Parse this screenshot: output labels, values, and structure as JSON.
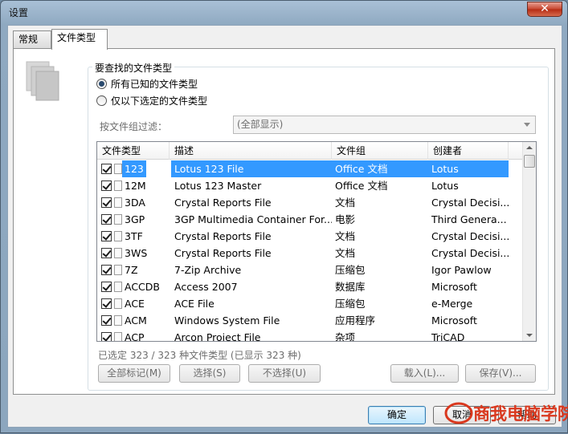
{
  "window": {
    "title": "设置",
    "close_label": "✕"
  },
  "tabs": [
    {
      "label": "常规",
      "active": false
    },
    {
      "label": "文件类型",
      "active": true
    }
  ],
  "group": {
    "title": "要查找的文件类型",
    "radio_all": "所有已知的文件类型",
    "radio_selected": "仅以下选定的文件类型",
    "radio_all_checked": true
  },
  "filter": {
    "label": "按文件组过滤：",
    "value": "(全部显示)"
  },
  "columns": [
    "文件类型",
    "描述",
    "文件组",
    "创建者"
  ],
  "rows": [
    {
      "type": "123",
      "desc": "Lotus 123 File",
      "group": "Office 文档",
      "creator": "Lotus",
      "selected": true
    },
    {
      "type": "12M",
      "desc": "Lotus 123 Master",
      "group": "Office 文档",
      "creator": "Lotus"
    },
    {
      "type": "3DA",
      "desc": "Crystal Reports File",
      "group": "文档",
      "creator": "Crystal Decisi..."
    },
    {
      "type": "3GP",
      "desc": "3GP Multimedia Container For...",
      "group": "电影",
      "creator": "Third Genera..."
    },
    {
      "type": "3TF",
      "desc": "Crystal Reports File",
      "group": "文档",
      "creator": "Crystal Decisi..."
    },
    {
      "type": "3WS",
      "desc": "Crystal Reports File",
      "group": "文档",
      "creator": "Crystal Decisi..."
    },
    {
      "type": "7Z",
      "desc": "7-Zip Archive",
      "group": "压缩包",
      "creator": "Igor Pawlow"
    },
    {
      "type": "ACCDB",
      "desc": "Access 2007",
      "group": "数据库",
      "creator": "Microsoft"
    },
    {
      "type": "ACE",
      "desc": "ACE File",
      "group": "压缩包",
      "creator": "e-Merge"
    },
    {
      "type": "ACM",
      "desc": "Windows System File",
      "group": "应用程序",
      "creator": "Microsoft"
    },
    {
      "type": "ACP",
      "desc": "Arcon Project File",
      "group": "杂项",
      "creator": "TriCAD"
    }
  ],
  "status": "已选定 323 / 323 种文件类型 (已显示 323 种)",
  "buttons": {
    "mark_all": "全部标记(M)",
    "select": "选择(S)",
    "unselect": "不选择(U)",
    "load": "载入(L)...",
    "save": "保存(V)...",
    "ok": "确定",
    "cancel": "取消",
    "help": "帮助"
  },
  "watermark": {
    "text": "商我电脑学院",
    "color": "#d9381e"
  },
  "colors": {
    "selection": "#3399ff",
    "title_gradient": "#a9c0d6"
  }
}
